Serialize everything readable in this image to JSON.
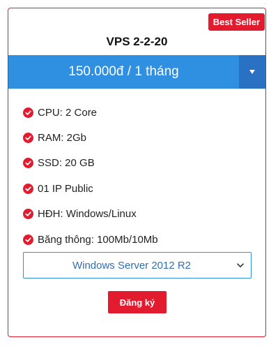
{
  "card": {
    "badge": "Best Seller",
    "title": "VPS 2-2-20",
    "price": "150.000đ / 1 tháng",
    "price_toggle_icon": "caret-down-icon",
    "features": [
      "CPU: 2 Core",
      "RAM: 2Gb",
      "SSD: 20 GB",
      "01 IP Public",
      "HĐH: Windows/Linux",
      "Băng thông: 100Mb/10Mb"
    ],
    "os_select": {
      "selected": "Windows Server 2012 R2"
    },
    "register_label": "Đăng ký"
  },
  "colors": {
    "accent_red": "#e31b2f",
    "price_blue": "#2f8fe0",
    "toggle_blue": "#2a70c3"
  }
}
